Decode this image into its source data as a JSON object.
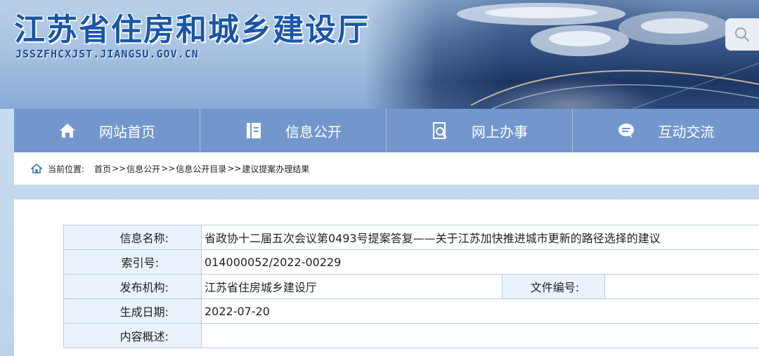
{
  "header": {
    "site_title": "江苏省住房和城乡建设厅",
    "site_domain": "JSSZFHCXJST.JIANGSU.GOV.CN"
  },
  "nav": {
    "items": [
      {
        "label": "网站首页",
        "icon": "home-icon"
      },
      {
        "label": "信息公开",
        "icon": "document-list-icon"
      },
      {
        "label": "网上办事",
        "icon": "search-document-icon"
      },
      {
        "label": "互动交流",
        "icon": "chat-bubble-icon"
      }
    ]
  },
  "breadcrumb": {
    "label": "当前位置:",
    "items": [
      "首页",
      "信息公开",
      "信息公开目录",
      "建议提案办理结果"
    ],
    "separator": ">>"
  },
  "meta": {
    "name_label": "信息名称:",
    "name_value": "省政协十二届五次会议第0493号提案答复——关于江苏加快推进城市更新的路径选择的建议",
    "index_label": "索引号:",
    "index_value": "014000052/2022-00229",
    "publisher_label": "发布机构:",
    "publisher_value": "江苏省住房城乡建设厅",
    "docno_label": "文件编号:",
    "docno_value": "",
    "date_label": "生成日期:",
    "date_value": "2022-07-20",
    "summary_label": "内容概述:",
    "summary_value": ""
  },
  "colors": {
    "nav_bg": "#7397cd",
    "title_blue": "#1a56a8",
    "label_cell_bg": "#eaf2fb"
  }
}
